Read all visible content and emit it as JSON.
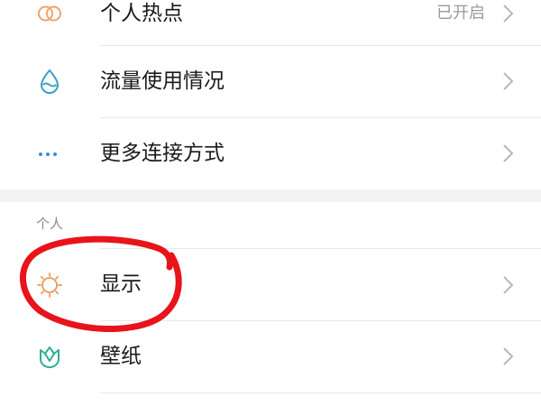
{
  "connection_items": [
    {
      "label": "个人热点",
      "value": "已开启",
      "icon": "hotspot-icon"
    },
    {
      "label": "流量使用情况",
      "value": "",
      "icon": "data-usage-icon"
    },
    {
      "label": "更多连接方式",
      "value": "",
      "icon": "more-connections-icon"
    }
  ],
  "personal_section": {
    "header": "个人",
    "items": [
      {
        "label": "显示",
        "icon": "display-brightness-icon"
      },
      {
        "label": "壁纸",
        "icon": "wallpaper-icon"
      }
    ]
  },
  "annotation": {
    "type": "hand-drawn circle",
    "color": "#e8131b",
    "target": "显示"
  },
  "colors": {
    "hotspot_icon": "#f0a46a",
    "data_usage_icon": "#3aa0c8",
    "more_icon": "#3a8fd8",
    "display_icon": "#e89a5c",
    "wallpaper_icon": "#2fae95"
  }
}
